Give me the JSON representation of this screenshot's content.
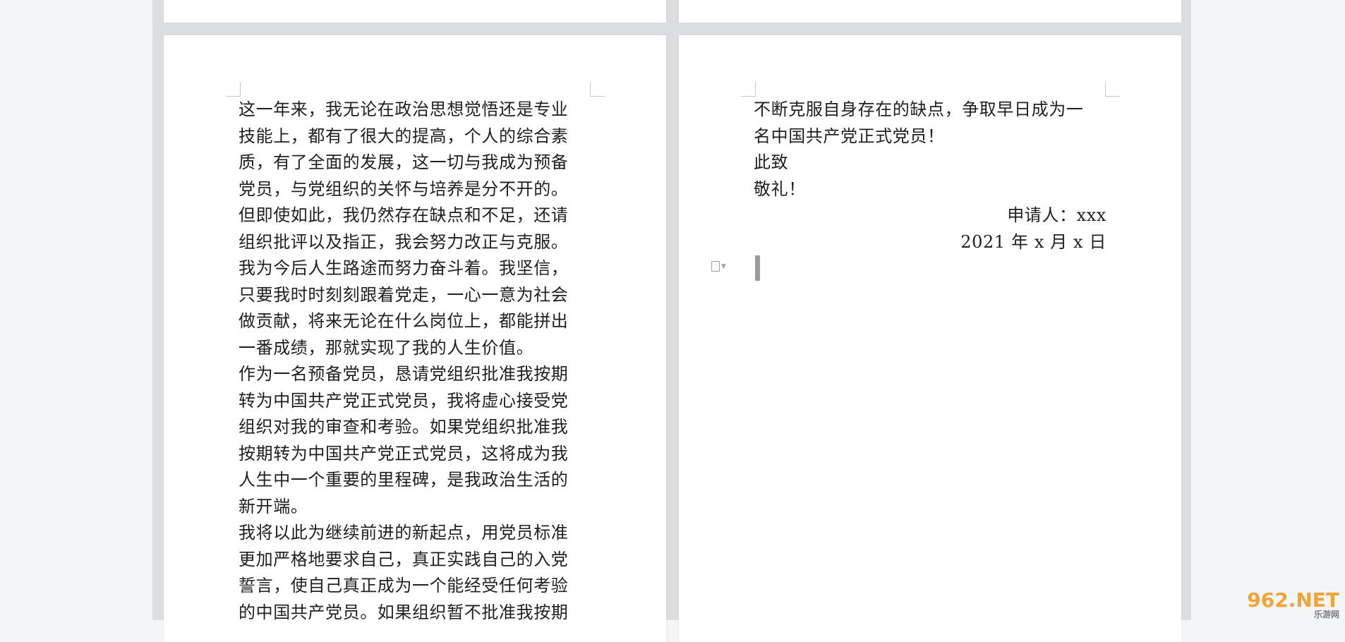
{
  "left_page": {
    "lines": [
      "这一年来，我无论在政治思想觉悟还是专业",
      "技能上，都有了很大的提高，个人的综合素",
      "质，有了全面的发展，这一切与我成为预备",
      "党员，与党组织的关怀与培养是分不开的。",
      "但即使如此，我仍然存在缺点和不足，还请",
      "组织批评以及指正，我会努力改正与克服。",
      "我为今后人生路途而努力奋斗着。我坚信，",
      "只要我时时刻刻跟着党走，一心一意为社会",
      "做贡献，将来无论在什么岗位上，都能拼出",
      "一番成绩，那就实现了我的人生价值。",
      "作为一名预备党员，恳请党组织批准我按期",
      "转为中国共产党正式党员，我将虚心接受党",
      "组织对我的审查和考验。如果党组织批准我",
      "按期转为中国共产党正式党员，这将成为我",
      "人生中一个重要的里程碑，是我政治生活的",
      "新开端。",
      "我将以此为继续前进的新起点，用党员标准",
      "更加严格地要求自己，真正实践自己的入党",
      "誓言，使自己真正成为一个能经受任何考验",
      "的中国共产党员。如果组织暂不批准我按期"
    ]
  },
  "right_page": {
    "lines": [
      "不断克服自身存在的缺点，争取早日成为一",
      "名中国共产党正式党员！",
      "此致",
      "敬礼！"
    ],
    "signature": "申请人：xxx",
    "date": "2021 年 x 月 x 日"
  },
  "icons": {
    "paragraph_menu": "document-icon"
  },
  "watermark": {
    "brand": "962.NET",
    "sub": "乐游网"
  }
}
